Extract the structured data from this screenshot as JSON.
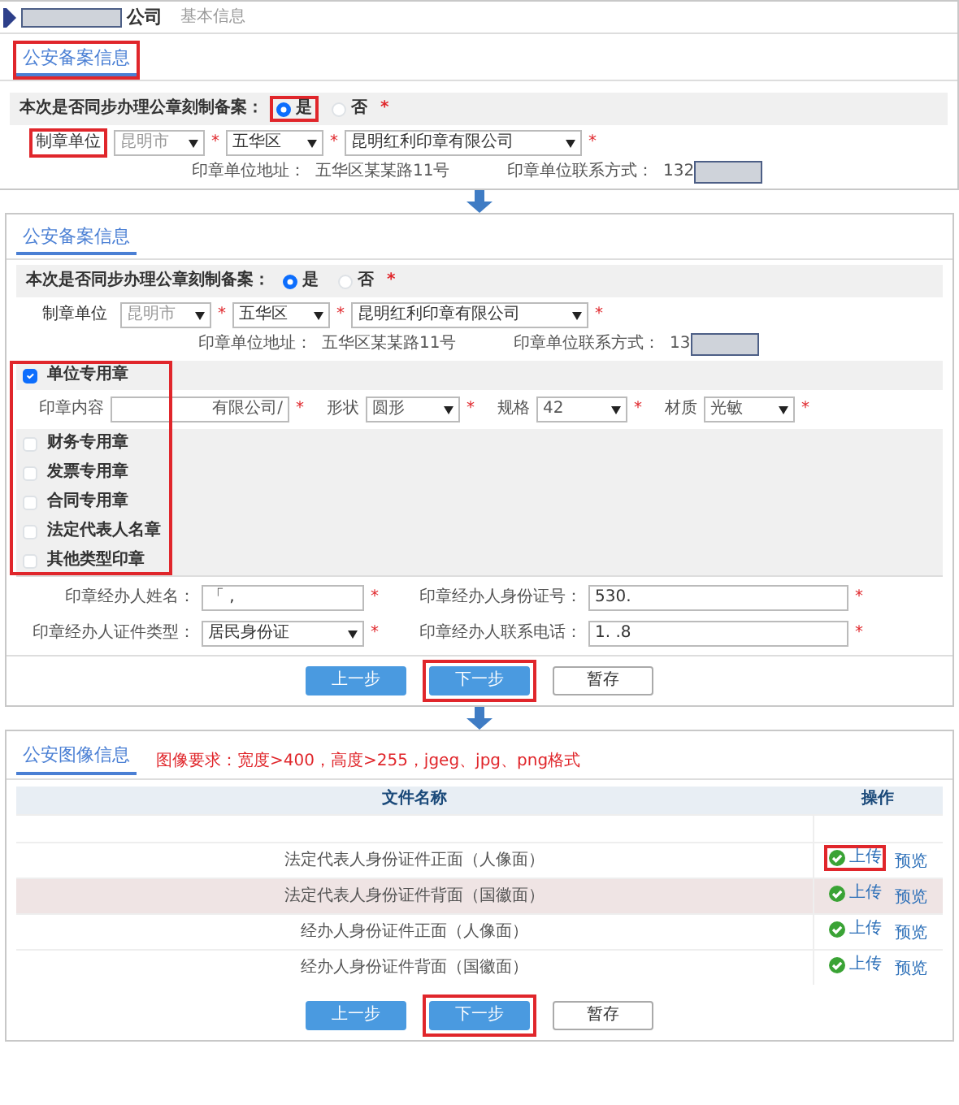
{
  "header": {
    "name_redacted": true,
    "name_suffix": "公司",
    "subtitle": "基本信息"
  },
  "panel_1": {
    "tab": {
      "label": "公安备案信息",
      "highlighted": true
    },
    "filing": {
      "question": "本次是否同步办理公章刻制备案：",
      "options": [
        {
          "label": "是",
          "selected": true,
          "highlighted": true
        },
        {
          "label": "否",
          "selected": false,
          "highlighted": false
        }
      ],
      "required_mark": "*",
      "maker_label": {
        "text": "制章单位",
        "highlighted": true
      },
      "selects": [
        {
          "value": "昆明市",
          "disabled": true,
          "required_mark": "*"
        },
        {
          "value": "五华区",
          "disabled": false,
          "required_mark": "*"
        },
        {
          "value": "昆明红利印章有限公司",
          "disabled": false,
          "required_mark": "*"
        }
      ],
      "address": {
        "label": "印章单位地址：",
        "value": "五华区某某路11号"
      },
      "contact": {
        "label": "印章单位联系方式：",
        "value": "132",
        "redacted": true
      }
    }
  },
  "panel_2": {
    "tab": {
      "label": "公安备案信息",
      "highlighted": false
    },
    "filing": {
      "question": "本次是否同步办理公章刻制备案：",
      "options": [
        {
          "label": "是",
          "selected": true,
          "highlighted": false
        },
        {
          "label": "否",
          "selected": false,
          "highlighted": false
        }
      ],
      "required_mark": "*",
      "maker_label": {
        "text": "制章单位",
        "highlighted": false
      },
      "selects": [
        {
          "value": "昆明市",
          "disabled": true,
          "required_mark": "*"
        },
        {
          "value": "五华区",
          "disabled": false,
          "required_mark": "*"
        },
        {
          "value": "昆明红利印章有限公司",
          "disabled": false,
          "required_mark": "*"
        }
      ],
      "address": {
        "label": "印章单位地址：",
        "value": "五华区某某路11号"
      },
      "contact": {
        "label": "印章单位联系方式：",
        "value": "13",
        "redacted": true
      }
    },
    "seals_highlighted": true,
    "seals": [
      {
        "label": "单位专用章",
        "checked": true,
        "fields": [
          {
            "kind": "text",
            "label": "印章内容",
            "value": "有限公司/",
            "required_mark": "*"
          },
          {
            "kind": "select",
            "label": "形状",
            "value": "圆形",
            "required_mark": "*"
          },
          {
            "kind": "select",
            "label": "规格",
            "value": "42",
            "required_mark": "*"
          },
          {
            "kind": "select",
            "label": "材质",
            "value": "光敏",
            "required_mark": "*"
          }
        ]
      },
      {
        "label": "财务专用章",
        "checked": false
      },
      {
        "label": "发票专用章",
        "checked": false
      },
      {
        "label": "合同专用章",
        "checked": false
      },
      {
        "label": "法定代表人名章",
        "checked": false
      },
      {
        "label": "其他类型印章",
        "checked": false
      }
    ],
    "agent_fields": [
      {
        "kind": "text",
        "label": "印章经办人姓名：",
        "value": "「 ,",
        "required_mark": "*"
      },
      {
        "kind": "text",
        "label": "印章经办人身份证号：",
        "value": "530.",
        "required_mark": "*"
      },
      {
        "kind": "select",
        "label": "印章经办人证件类型：",
        "value": "居民身份证",
        "required_mark": "*"
      },
      {
        "kind": "text",
        "label": "印章经办人联系电话：",
        "value": "1.  .8",
        "required_mark": "*"
      }
    ],
    "buttons": [
      {
        "label": "上一步",
        "kind": "primary",
        "highlighted": false
      },
      {
        "label": "下一步",
        "kind": "primary",
        "highlighted": true
      },
      {
        "label": "暂存",
        "kind": "default",
        "highlighted": false
      }
    ]
  },
  "panel_3": {
    "tab": {
      "label": "公安图像信息",
      "highlighted": false
    },
    "note": "图像要求：宽度>400，高度>255，jgeg、jpg、png格式",
    "table": {
      "columns": [
        "文件名称",
        "操作"
      ],
      "rows": [
        {
          "file_name": "法定代表人身份证件正面（人像面）",
          "selected": false,
          "actions": [
            {
              "kind": "upload",
              "label": "上传",
              "highlighted": true
            },
            {
              "kind": "preview",
              "label": "预览",
              "highlighted": false
            }
          ]
        },
        {
          "file_name": "法定代表人身份证件背面（国徽面）",
          "selected": true,
          "actions": [
            {
              "kind": "upload",
              "label": "上传",
              "highlighted": false
            },
            {
              "kind": "preview",
              "label": "预览",
              "highlighted": false
            }
          ]
        },
        {
          "file_name": "经办人身份证件正面（人像面）",
          "selected": false,
          "actions": [
            {
              "kind": "upload",
              "label": "上传",
              "highlighted": false
            },
            {
              "kind": "preview",
              "label": "预览",
              "highlighted": false
            }
          ]
        },
        {
          "file_name": "经办人身份证件背面（国徽面）",
          "selected": false,
          "actions": [
            {
              "kind": "upload",
              "label": "上传",
              "highlighted": false
            },
            {
              "kind": "preview",
              "label": "预览",
              "highlighted": false
            }
          ]
        }
      ]
    },
    "buttons": [
      {
        "label": "上一步",
        "kind": "primary",
        "highlighted": false
      },
      {
        "label": "下一步",
        "kind": "primary",
        "highlighted": true
      },
      {
        "label": "暂存",
        "kind": "default",
        "highlighted": false
      }
    ]
  }
}
